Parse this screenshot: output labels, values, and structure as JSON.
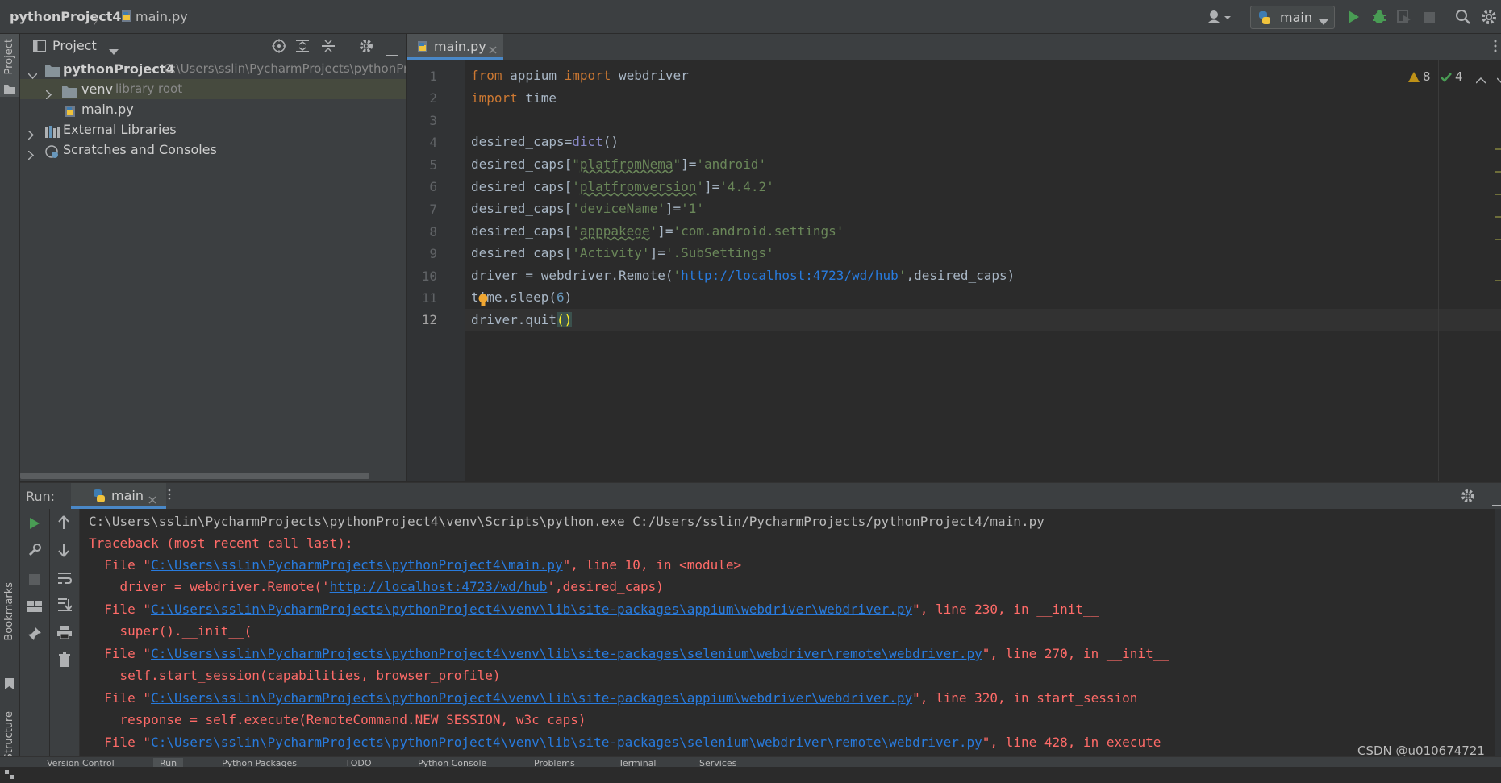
{
  "topbar": {
    "project": "pythonProject4",
    "separator": "〉",
    "file": "main.py",
    "run_config": "main"
  },
  "left_strip": {
    "project_label": "Project",
    "bookmarks_label": "Bookmarks",
    "structure_label": "Structure"
  },
  "project_panel": {
    "title": "Project",
    "root_name": "pythonProject4",
    "root_path": "C:\\Users\\sslin\\PycharmProjects\\pythonPro",
    "venv": "venv",
    "venv_hint": "library root",
    "main_file": "main.py",
    "external": "External Libraries",
    "scratches": "Scratches and Consoles"
  },
  "editor": {
    "tab": "main.py",
    "warnings": "8",
    "checks": "4",
    "line_numbers": [
      "1",
      "2",
      "3",
      "4",
      "5",
      "6",
      "7",
      "8",
      "9",
      "10",
      "11",
      "12"
    ]
  },
  "run": {
    "label": "Run:",
    "tab": "main",
    "cmd": "C:\\Users\\sslin\\PycharmProjects\\pythonProject4\\venv\\Scripts\\python.exe C:/Users/sslin/PycharmProjects/pythonProject4/main.py",
    "traceback": "Traceback (most recent call last):",
    "f1_path": "C:\\Users\\sslin\\PycharmProjects\\pythonProject4\\main.py",
    "f1_tail": "\", line 10, in <module>",
    "f1_code_a": "    driver = webdriver.Remote('",
    "f1_code_url": "http://localhost:4723/wd/hub",
    "f1_code_b": "',desired_caps)",
    "f2_path": "C:\\Users\\sslin\\PycharmProjects\\pythonProject4\\venv\\lib\\site-packages\\appium\\webdriver\\webdriver.py",
    "f2_tail": "\", line 230, in __init__",
    "f2_code": "    super().__init__(",
    "f3_path": "C:\\Users\\sslin\\PycharmProjects\\pythonProject4\\venv\\lib\\site-packages\\selenium\\webdriver\\remote\\webdriver.py",
    "f3_tail": "\", line 270, in __init__",
    "f3_code": "    self.start_session(capabilities, browser_profile)",
    "f4_path": "C:\\Users\\sslin\\PycharmProjects\\pythonProject4\\venv\\lib\\site-packages\\appium\\webdriver\\webdriver.py",
    "f4_tail": "\", line 320, in start_session",
    "f4_code": "    response = self.execute(RemoteCommand.NEW_SESSION, w3c_caps)",
    "f5_path": "C:\\Users\\sslin\\PycharmProjects\\pythonProject4\\venv\\lib\\site-packages\\selenium\\webdriver\\remote\\webdriver.py",
    "f5_tail": "\", line 428, in execute",
    "file_prefix": "  File \""
  },
  "watermark": "CSDN @u010674721",
  "statusbar": {
    "items": [
      "Version Control",
      "Run",
      "Python Packages",
      "TODO",
      "Python Console",
      "Problems",
      "Terminal",
      "Services"
    ]
  },
  "colors": {
    "bg": "#2b2b2b",
    "panel": "#3c3f41",
    "error": "#ff6b68",
    "link": "#287bde",
    "keyword": "#cc7832",
    "string": "#6a8759"
  }
}
